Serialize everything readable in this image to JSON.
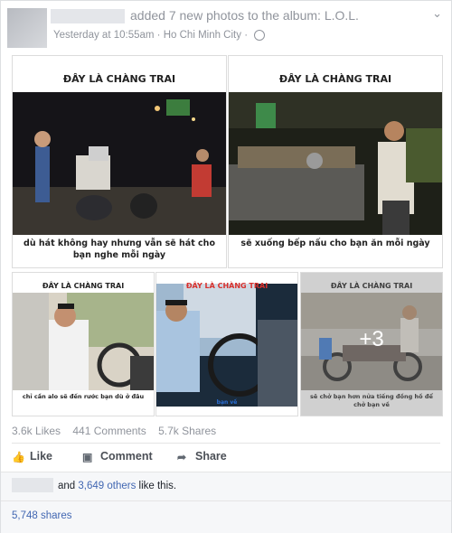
{
  "post": {
    "action_text": "added 7 new photos to the album: L.O.L.",
    "time": "Yesterday at 10:55am",
    "location": "Ho Chi Minh City",
    "separator": "·"
  },
  "photos": [
    {
      "top_caption": "ĐÂY LÀ CHÀNG TRAI",
      "bottom_caption": "dù hát không hay nhưng vẫn sẽ hát cho bạn nghe mỗi ngày"
    },
    {
      "top_caption": "ĐÂY LÀ CHÀNG TRAI",
      "bottom_caption": "sẽ xuống bếp nấu cho bạn ăn mỗi ngày"
    },
    {
      "top_caption": "ĐÂY LÀ CHÀNG TRAI",
      "bottom_caption": "chỉ cần alo sẽ đến rước bạn dù ở đâu"
    },
    {
      "top_caption": "ĐÂY LÀ CHÀNG TRAI",
      "bottom_caption": "bạn về"
    },
    {
      "top_caption": "ĐÂY LÀ CHÀNG TRAI",
      "bottom_caption": "sẽ chở bạn hơn nửa tiếng đồng hồ để chở bạn về",
      "more_count": "+3"
    }
  ],
  "stats": {
    "likes": "3.6k Likes",
    "comments": "441 Comments",
    "shares": "5.7k Shares"
  },
  "actions": {
    "like": "Like",
    "comment": "Comment",
    "share": "Share"
  },
  "likes_summary": {
    "prefix": "and ",
    "others": "3,649 others",
    "suffix": " like this."
  },
  "shares_total": "5,748 shares",
  "colors": {
    "link": "#4267b2",
    "meta": "#90949c"
  }
}
